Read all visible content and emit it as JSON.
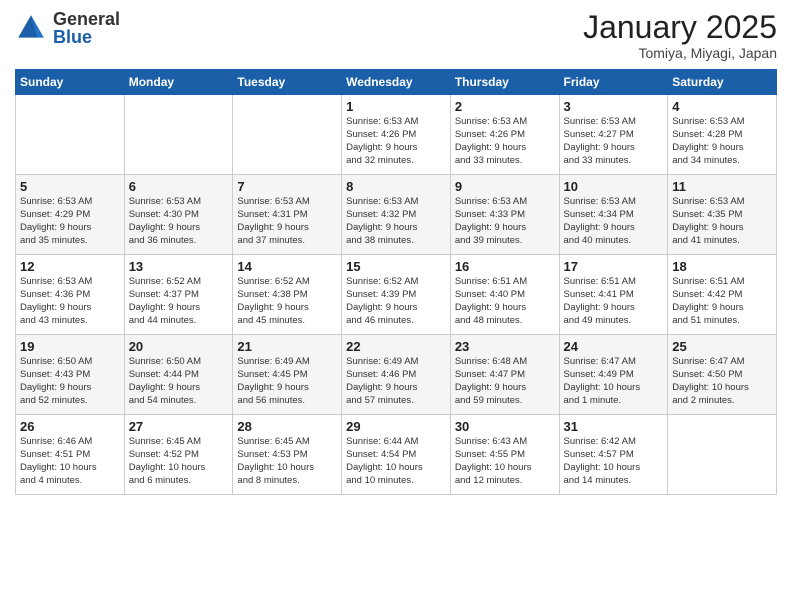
{
  "header": {
    "logo_general": "General",
    "logo_blue": "Blue",
    "month_year": "January 2025",
    "location": "Tomiya, Miyagi, Japan"
  },
  "days_of_week": [
    "Sunday",
    "Monday",
    "Tuesday",
    "Wednesday",
    "Thursday",
    "Friday",
    "Saturday"
  ],
  "weeks": [
    [
      {
        "day": "",
        "info": ""
      },
      {
        "day": "",
        "info": ""
      },
      {
        "day": "",
        "info": ""
      },
      {
        "day": "1",
        "info": "Sunrise: 6:53 AM\nSunset: 4:26 PM\nDaylight: 9 hours\nand 32 minutes."
      },
      {
        "day": "2",
        "info": "Sunrise: 6:53 AM\nSunset: 4:26 PM\nDaylight: 9 hours\nand 33 minutes."
      },
      {
        "day": "3",
        "info": "Sunrise: 6:53 AM\nSunset: 4:27 PM\nDaylight: 9 hours\nand 33 minutes."
      },
      {
        "day": "4",
        "info": "Sunrise: 6:53 AM\nSunset: 4:28 PM\nDaylight: 9 hours\nand 34 minutes."
      }
    ],
    [
      {
        "day": "5",
        "info": "Sunrise: 6:53 AM\nSunset: 4:29 PM\nDaylight: 9 hours\nand 35 minutes."
      },
      {
        "day": "6",
        "info": "Sunrise: 6:53 AM\nSunset: 4:30 PM\nDaylight: 9 hours\nand 36 minutes."
      },
      {
        "day": "7",
        "info": "Sunrise: 6:53 AM\nSunset: 4:31 PM\nDaylight: 9 hours\nand 37 minutes."
      },
      {
        "day": "8",
        "info": "Sunrise: 6:53 AM\nSunset: 4:32 PM\nDaylight: 9 hours\nand 38 minutes."
      },
      {
        "day": "9",
        "info": "Sunrise: 6:53 AM\nSunset: 4:33 PM\nDaylight: 9 hours\nand 39 minutes."
      },
      {
        "day": "10",
        "info": "Sunrise: 6:53 AM\nSunset: 4:34 PM\nDaylight: 9 hours\nand 40 minutes."
      },
      {
        "day": "11",
        "info": "Sunrise: 6:53 AM\nSunset: 4:35 PM\nDaylight: 9 hours\nand 41 minutes."
      }
    ],
    [
      {
        "day": "12",
        "info": "Sunrise: 6:53 AM\nSunset: 4:36 PM\nDaylight: 9 hours\nand 43 minutes."
      },
      {
        "day": "13",
        "info": "Sunrise: 6:52 AM\nSunset: 4:37 PM\nDaylight: 9 hours\nand 44 minutes."
      },
      {
        "day": "14",
        "info": "Sunrise: 6:52 AM\nSunset: 4:38 PM\nDaylight: 9 hours\nand 45 minutes."
      },
      {
        "day": "15",
        "info": "Sunrise: 6:52 AM\nSunset: 4:39 PM\nDaylight: 9 hours\nand 46 minutes."
      },
      {
        "day": "16",
        "info": "Sunrise: 6:51 AM\nSunset: 4:40 PM\nDaylight: 9 hours\nand 48 minutes."
      },
      {
        "day": "17",
        "info": "Sunrise: 6:51 AM\nSunset: 4:41 PM\nDaylight: 9 hours\nand 49 minutes."
      },
      {
        "day": "18",
        "info": "Sunrise: 6:51 AM\nSunset: 4:42 PM\nDaylight: 9 hours\nand 51 minutes."
      }
    ],
    [
      {
        "day": "19",
        "info": "Sunrise: 6:50 AM\nSunset: 4:43 PM\nDaylight: 9 hours\nand 52 minutes."
      },
      {
        "day": "20",
        "info": "Sunrise: 6:50 AM\nSunset: 4:44 PM\nDaylight: 9 hours\nand 54 minutes."
      },
      {
        "day": "21",
        "info": "Sunrise: 6:49 AM\nSunset: 4:45 PM\nDaylight: 9 hours\nand 56 minutes."
      },
      {
        "day": "22",
        "info": "Sunrise: 6:49 AM\nSunset: 4:46 PM\nDaylight: 9 hours\nand 57 minutes."
      },
      {
        "day": "23",
        "info": "Sunrise: 6:48 AM\nSunset: 4:47 PM\nDaylight: 9 hours\nand 59 minutes."
      },
      {
        "day": "24",
        "info": "Sunrise: 6:47 AM\nSunset: 4:49 PM\nDaylight: 10 hours\nand 1 minute."
      },
      {
        "day": "25",
        "info": "Sunrise: 6:47 AM\nSunset: 4:50 PM\nDaylight: 10 hours\nand 2 minutes."
      }
    ],
    [
      {
        "day": "26",
        "info": "Sunrise: 6:46 AM\nSunset: 4:51 PM\nDaylight: 10 hours\nand 4 minutes."
      },
      {
        "day": "27",
        "info": "Sunrise: 6:45 AM\nSunset: 4:52 PM\nDaylight: 10 hours\nand 6 minutes."
      },
      {
        "day": "28",
        "info": "Sunrise: 6:45 AM\nSunset: 4:53 PM\nDaylight: 10 hours\nand 8 minutes."
      },
      {
        "day": "29",
        "info": "Sunrise: 6:44 AM\nSunset: 4:54 PM\nDaylight: 10 hours\nand 10 minutes."
      },
      {
        "day": "30",
        "info": "Sunrise: 6:43 AM\nSunset: 4:55 PM\nDaylight: 10 hours\nand 12 minutes."
      },
      {
        "day": "31",
        "info": "Sunrise: 6:42 AM\nSunset: 4:57 PM\nDaylight: 10 hours\nand 14 minutes."
      },
      {
        "day": "",
        "info": ""
      }
    ]
  ]
}
